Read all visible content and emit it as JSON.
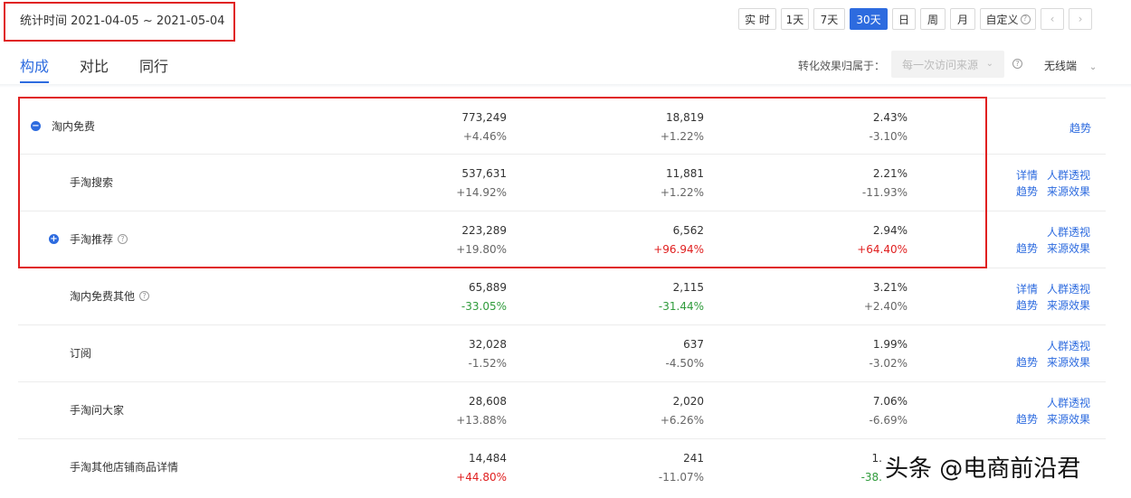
{
  "header": {
    "date_range": "统计时间 2021-04-05 ~ 2021-05-04",
    "period_buttons": [
      "实 时",
      "1天",
      "7天",
      "30天",
      "日",
      "周",
      "月",
      "自定义"
    ],
    "custom_help": "?",
    "prev": "‹",
    "next": "›"
  },
  "tabs": [
    "构成",
    "对比",
    "同行"
  ],
  "attribution": {
    "label": "转化效果归属于：",
    "select_value": "每一次访问来源",
    "help": "?",
    "device": "无线端"
  },
  "rows": [
    {
      "name": "淘内免费",
      "toggle": "−",
      "m1": "773,249",
      "c1": "+4.46%",
      "m2": "18,819",
      "c2": "+1.22%",
      "m3": "2.43%",
      "c3": "-3.10%",
      "links": {
        "trend": "趋势"
      }
    },
    {
      "name": "手淘搜索",
      "m1": "537,631",
      "c1": "+14.92%",
      "m2": "11,881",
      "c2": "+1.22%",
      "m3": "2.21%",
      "c3": "-11.93%",
      "links": {
        "detail": "详情",
        "crowd": "人群透视",
        "trend": "趋势",
        "source": "来源效果"
      }
    },
    {
      "name": "手淘推荐",
      "toggle": "+",
      "help": "?",
      "m1": "223,289",
      "c1": "+19.80%",
      "m2": "6,562",
      "c2": "+96.94%",
      "m3": "2.94%",
      "c3": "+64.40%",
      "links": {
        "crowd": "人群透视",
        "trend": "趋势",
        "source": "来源效果"
      }
    },
    {
      "name": "淘内免费其他",
      "help": "?",
      "m1": "65,889",
      "c1": "-33.05%",
      "m2": "2,115",
      "c2": "-31.44%",
      "m3": "3.21%",
      "c3": "+2.40%",
      "links": {
        "detail": "详情",
        "crowd": "人群透视",
        "trend": "趋势",
        "source": "来源效果"
      }
    },
    {
      "name": "订阅",
      "m1": "32,028",
      "c1": "-1.52%",
      "m2": "637",
      "c2": "-4.50%",
      "m3": "1.99%",
      "c3": "-3.02%",
      "links": {
        "crowd": "人群透视",
        "trend": "趋势",
        "source": "来源效果"
      }
    },
    {
      "name": "手淘问大家",
      "m1": "28,608",
      "c1": "+13.88%",
      "m2": "2,020",
      "c2": "+6.26%",
      "m3": "7.06%",
      "c3": "-6.69%",
      "links": {
        "crowd": "人群透视",
        "trend": "趋势",
        "source": "来源效果"
      }
    },
    {
      "name": "手淘其他店铺商品详情",
      "m1": "14,484",
      "c1": "+44.80%",
      "m2": "241",
      "c2": "-11.07%",
      "m3": "1.",
      "c3": "-38.",
      "links": {}
    }
  ],
  "watermark": "头条 @电商前沿君",
  "colors": {
    "accent": "#2d6bdf",
    "up": "#e02020",
    "down": "#2f9b3b",
    "highlight": "#e02020"
  }
}
